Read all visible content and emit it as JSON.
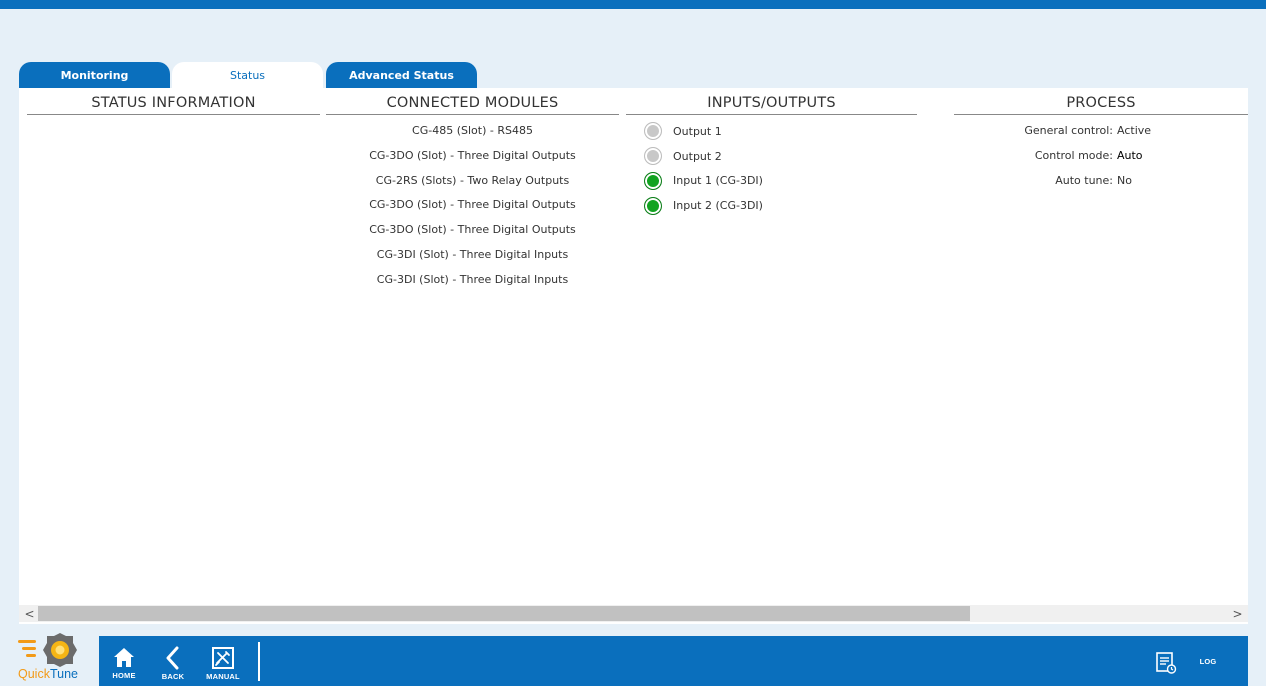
{
  "tabs": [
    {
      "label": "Monitoring",
      "active": false
    },
    {
      "label": "Status",
      "active": true
    },
    {
      "label": "Advanced Status",
      "active": false
    }
  ],
  "columns": {
    "status_information": {
      "title": "STATUS INFORMATION"
    },
    "connected_modules": {
      "title": "CONNECTED MODULES",
      "items": [
        "CG-485 (Slot) - RS485",
        "CG-3DO (Slot) - Three Digital Outputs",
        "CG-2RS (Slots) - Two Relay Outputs",
        "CG-3DO (Slot) - Three Digital Outputs",
        "CG-3DO (Slot) - Three Digital Outputs",
        "CG-3DI (Slot) - Three Digital Inputs",
        "CG-3DI (Slot) - Three Digital Inputs"
      ]
    },
    "inputs_outputs": {
      "title": "INPUTS/OUTPUTS",
      "items": [
        {
          "label": "Output 1",
          "state": "off"
        },
        {
          "label": "Output 2",
          "state": "off"
        },
        {
          "label": "Input 1 (CG-3DI)",
          "state": "on"
        },
        {
          "label": "Input 2 (CG-3DI)",
          "state": "on"
        }
      ]
    },
    "process": {
      "title": "PROCESS",
      "items": [
        {
          "label": "General control:",
          "value": "Active"
        },
        {
          "label": "Control mode:",
          "value": "Auto"
        },
        {
          "label": "Auto tune:",
          "value": "No"
        }
      ]
    }
  },
  "scrollbar": {
    "left_arrow": "<",
    "right_arrow": ">"
  },
  "logo": {
    "part1": "Quick",
    "part2": "Tune"
  },
  "bottom_nav": {
    "home": "HOME",
    "back": "BACK",
    "manual": "MANUAL",
    "log": "LOG"
  },
  "colors": {
    "brand_blue": "#0a6fbd",
    "led_on": "#12a321",
    "led_off": "#c8c8c8",
    "logo_orange": "#f29a17"
  }
}
